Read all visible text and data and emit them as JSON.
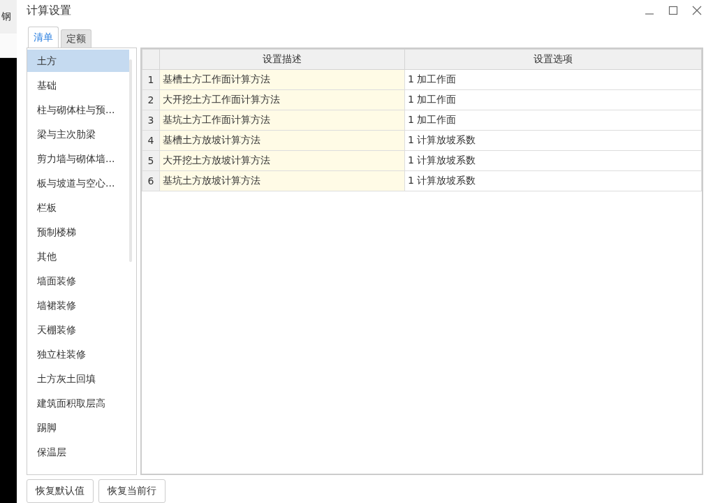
{
  "background_window": {
    "label": "钢"
  },
  "window": {
    "title": "计算设置"
  },
  "tabs": [
    {
      "label": "清单",
      "selected": true
    },
    {
      "label": "定额",
      "selected": false
    }
  ],
  "categories": [
    {
      "label": "土方",
      "selected": true
    },
    {
      "label": "基础",
      "selected": false
    },
    {
      "label": "柱与砌体柱与预...",
      "selected": false
    },
    {
      "label": "梁与主次肋梁",
      "selected": false
    },
    {
      "label": "剪力墙与砌体墙...",
      "selected": false
    },
    {
      "label": "板与坡道与空心...",
      "selected": false
    },
    {
      "label": "栏板",
      "selected": false
    },
    {
      "label": "预制楼梯",
      "selected": false
    },
    {
      "label": "其他",
      "selected": false
    },
    {
      "label": "墙面装修",
      "selected": false
    },
    {
      "label": "墙裙装修",
      "selected": false
    },
    {
      "label": "天棚装修",
      "selected": false
    },
    {
      "label": "独立柱装修",
      "selected": false
    },
    {
      "label": "土方灰土回填",
      "selected": false
    },
    {
      "label": "建筑面积取层高",
      "selected": false
    },
    {
      "label": "踢脚",
      "selected": false
    },
    {
      "label": "保温层",
      "selected": false
    }
  ],
  "table": {
    "columns": [
      "设置描述",
      "设置选项"
    ],
    "rows": [
      {
        "number": "1",
        "description": "基槽土方工作面计算方法",
        "option": "1 加工作面"
      },
      {
        "number": "2",
        "description": "大开挖土方工作面计算方法",
        "option": "1 加工作面"
      },
      {
        "number": "3",
        "description": "基坑土方工作面计算方法",
        "option": "1 加工作面"
      },
      {
        "number": "4",
        "description": "基槽土方放坡计算方法",
        "option": "1 计算放坡系数"
      },
      {
        "number": "5",
        "description": "大开挖土方放坡计算方法",
        "option": "1 计算放坡系数"
      },
      {
        "number": "6",
        "description": "基坑土方放坡计算方法",
        "option": "1 计算放坡系数"
      }
    ]
  },
  "buttons": [
    "恢复默认值",
    "恢复当前行"
  ]
}
